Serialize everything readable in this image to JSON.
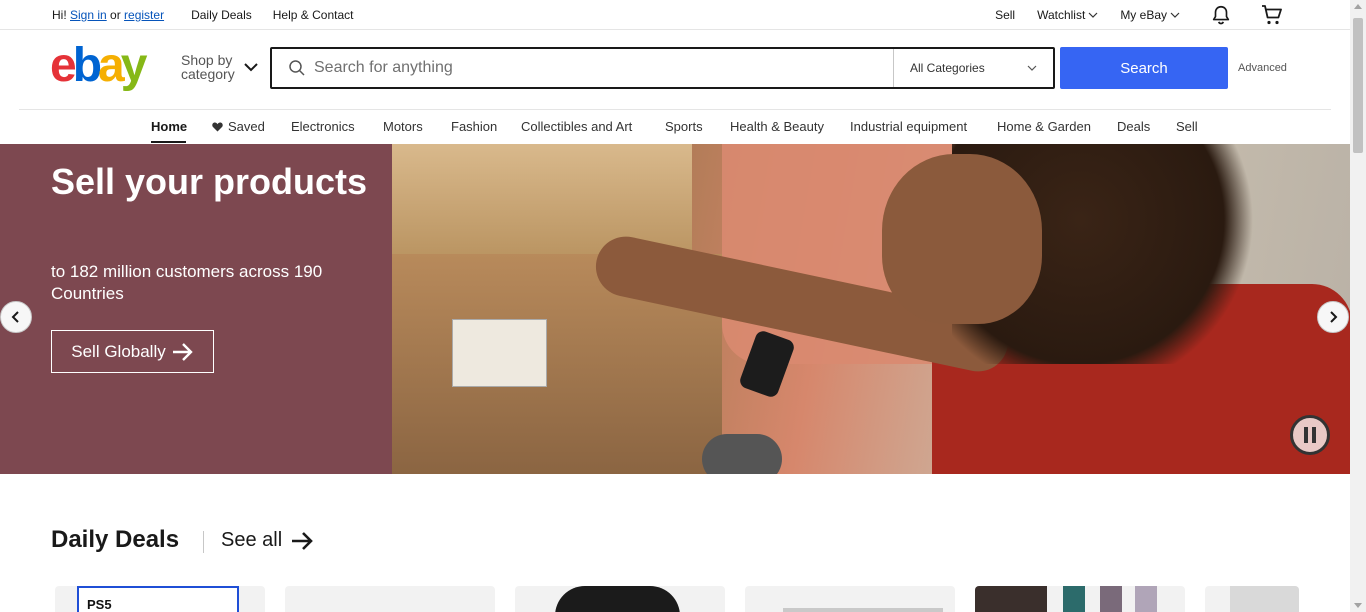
{
  "topbar": {
    "greeting_prefix": "Hi! ",
    "sign_in": "Sign in",
    "or": " or ",
    "register": "register",
    "daily_deals": "Daily Deals",
    "help_contact": "Help & Contact",
    "sell": "Sell",
    "watchlist": "Watchlist",
    "my_ebay": "My eBay"
  },
  "header": {
    "logo_text": "ebay",
    "logo_colors": [
      "#e53238",
      "#0064d2",
      "#f5af02",
      "#86b817"
    ],
    "shop_by_line1": "Shop by",
    "shop_by_line2": "category",
    "search_placeholder": "Search for anything",
    "category_selected": "All Categories",
    "search_button": "Search",
    "advanced": "Advanced",
    "accent_color": "#3665f3"
  },
  "nav": {
    "items": [
      {
        "label": "Home",
        "active": true
      },
      {
        "label": "Saved",
        "icon": "heart-icon"
      },
      {
        "label": "Electronics"
      },
      {
        "label": "Motors"
      },
      {
        "label": "Fashion"
      },
      {
        "label": "Collectibles and Art"
      },
      {
        "label": "Sports"
      },
      {
        "label": "Health & Beauty"
      },
      {
        "label": "Industrial equipment"
      },
      {
        "label": "Home & Garden"
      },
      {
        "label": "Deals"
      },
      {
        "label": "Sell"
      }
    ]
  },
  "hero": {
    "title": "Sell your products",
    "subtitle": "to 182 million customers across 190 Countries",
    "cta": "Sell Globally",
    "panel_color": "#7d4850"
  },
  "deals": {
    "title": "Daily Deals",
    "see_all": "See all",
    "first_card_text": "PS5"
  }
}
